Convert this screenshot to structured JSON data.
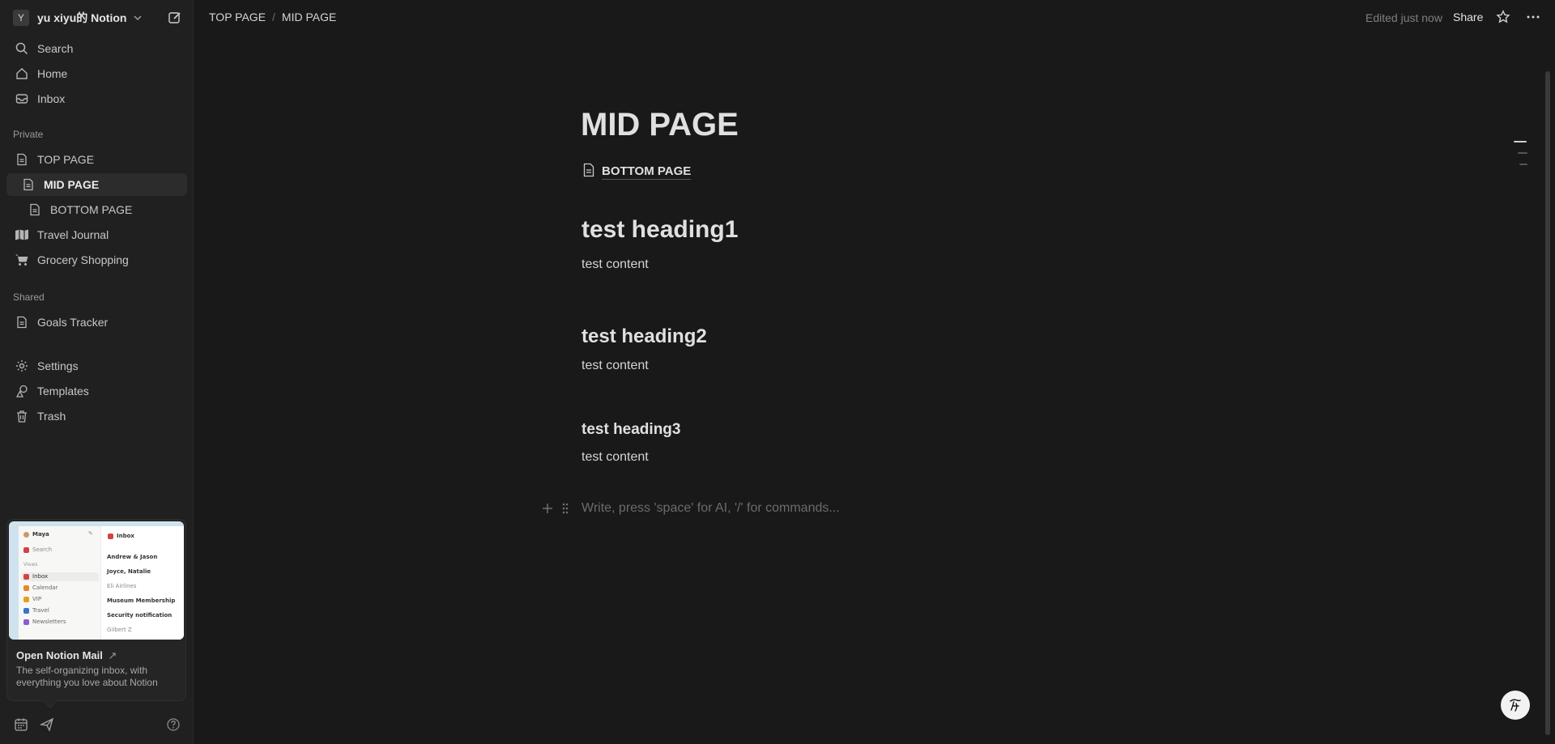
{
  "workspace": {
    "avatar_letter": "Y",
    "name": "yu xiyu的 Notion"
  },
  "nav": {
    "search": "Search",
    "home": "Home",
    "inbox": "Inbox"
  },
  "sections": {
    "private": "Private",
    "shared": "Shared"
  },
  "private_pages": {
    "top": "TOP PAGE",
    "mid": "MID PAGE",
    "bottom": "BOTTOM PAGE",
    "travel": "Travel Journal",
    "grocery": "Grocery Shopping"
  },
  "shared_pages": {
    "goals": "Goals Tracker"
  },
  "utility": {
    "settings": "Settings",
    "templates": "Templates",
    "trash": "Trash"
  },
  "promo": {
    "title": "Open Notion Mail",
    "arrow": "↗",
    "description": "The self-organizing inbox, with everything you love about Notion",
    "preview": {
      "user": "Maya",
      "search": "Search",
      "views_label": "Views",
      "views": [
        "Inbox",
        "Calendar",
        "VIP",
        "Travel",
        "Newsletters"
      ],
      "inbox_title": "Inbox",
      "threads": [
        "Andrew & Jason",
        "Joyce, Natalie",
        "Eli Airlines",
        "Museum Membership",
        "Security notification",
        "Gilbert Z"
      ]
    }
  },
  "topbar": {
    "breadcrumb": [
      "TOP PAGE",
      "MID PAGE"
    ],
    "separator": "/",
    "edited": "Edited just now",
    "share": "Share"
  },
  "page": {
    "title": "MID PAGE",
    "subpage_link": "BOTTOM PAGE",
    "heading1": "test heading1",
    "content1": "test content",
    "heading2": "test heading2",
    "content2": "test content",
    "heading3": "test heading3",
    "content3": "test content",
    "placeholder": "Write, press 'space' for AI, '/' for commands..."
  },
  "colors": {
    "background": "#191919",
    "sidebar": "#202020",
    "active_item": "#2c2c2c"
  }
}
